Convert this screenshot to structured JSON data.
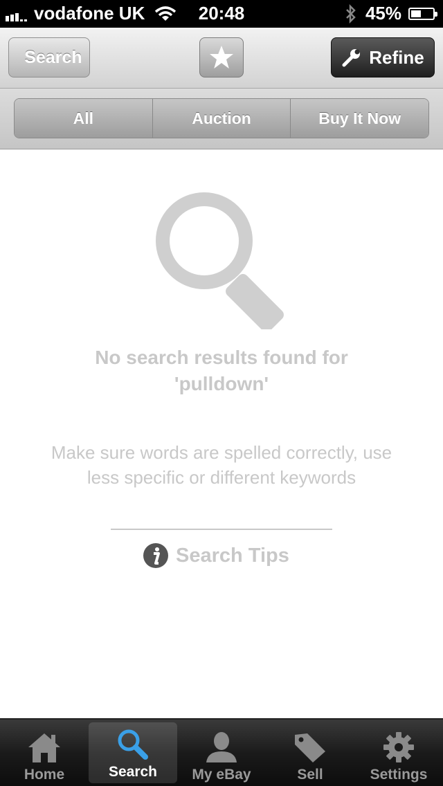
{
  "status_bar": {
    "carrier": "vodafone UK",
    "time": "20:48",
    "battery": "45%",
    "battery_level": 0.45
  },
  "nav": {
    "back_label": "Search",
    "refine_label": "Refine"
  },
  "segments": [
    "All",
    "Auction",
    "Buy It Now"
  ],
  "empty_state": {
    "title_line1": "No search results found for",
    "title_line2": "'pulldown'",
    "hint_line1": "Make sure words are spelled correctly, use",
    "hint_line2": "less specific or different keywords",
    "tips_label": "Search Tips"
  },
  "tabs": [
    {
      "label": "Home",
      "icon": "home-icon"
    },
    {
      "label": "Search",
      "icon": "search-icon",
      "active": true
    },
    {
      "label": "My eBay",
      "icon": "person-icon"
    },
    {
      "label": "Sell",
      "icon": "tag-icon"
    },
    {
      "label": "Settings",
      "icon": "gear-icon"
    }
  ],
  "colors": {
    "accent_blue": "#3aa0e8",
    "empty_text": "#c8c8c8"
  }
}
